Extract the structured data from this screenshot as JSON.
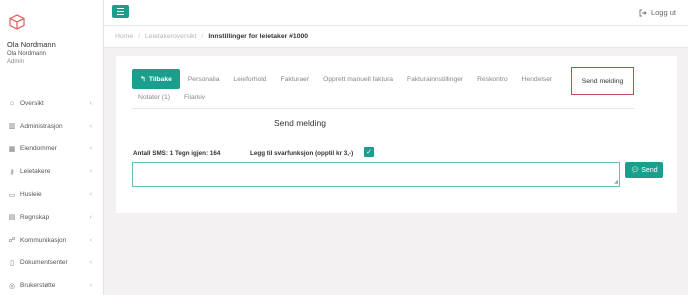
{
  "user": {
    "name": "Ola Nordmann",
    "subname": "Ola Nordmann",
    "role": "Admin"
  },
  "sidebar": {
    "items": [
      {
        "label": "Oversikt",
        "icon": "home-icon"
      },
      {
        "label": "Administrasjon",
        "icon": "bank-icon"
      },
      {
        "label": "Eiendommer",
        "icon": "building-icon"
      },
      {
        "label": "Leietakere",
        "icon": "key-icon"
      },
      {
        "label": "Husleie",
        "icon": "money-icon"
      },
      {
        "label": "Regnskap",
        "icon": "calculator-icon"
      },
      {
        "label": "Kommunikasjon",
        "icon": "chat-icon"
      },
      {
        "label": "Dokumentsenter",
        "icon": "document-icon"
      },
      {
        "label": "Brukerstøtte",
        "icon": "lifebuoy-icon"
      }
    ]
  },
  "topbar": {
    "logout_label": "Logg ut"
  },
  "breadcrumb": {
    "home": "Home",
    "sep": "/",
    "parent": "Leietakeroversikt",
    "current": "Innstillinger for leietaker #1000"
  },
  "tabs": {
    "back": "Tilbake",
    "row1": [
      "Personalia",
      "Leieforhold",
      "Fakturaer",
      "Opprett manuell faktura",
      "Fakturainnstillinger",
      "Reskontro",
      "Hendelser"
    ],
    "active": "Send melding",
    "row2": [
      "Notater (1)",
      "Filarkiv"
    ]
  },
  "form": {
    "title": "Send melding",
    "sms_counter": "Antall SMS: 1 Tegn igjen: 164",
    "reply_label": "Legg til svarfunksjon (opptil kr 3,-)",
    "reply_checked": true,
    "message_value": "",
    "send_label": "Send"
  },
  "colors": {
    "accent": "#1a9f8c",
    "highlight_border": "#c9484a"
  }
}
